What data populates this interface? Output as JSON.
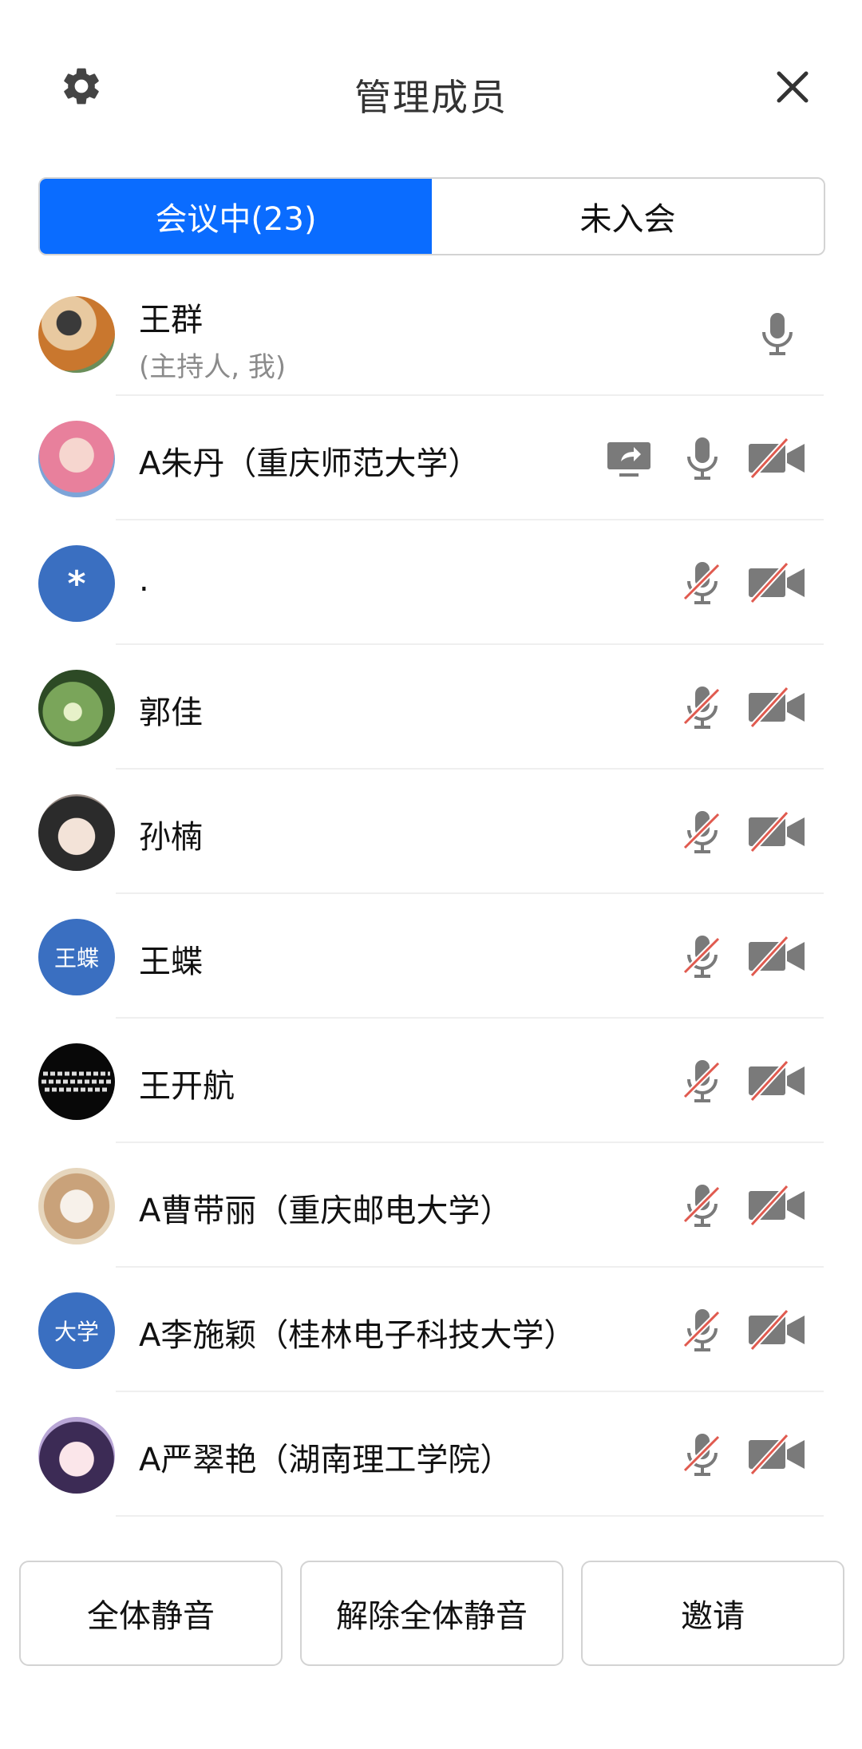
{
  "header": {
    "title": "管理成员",
    "settings_icon": "gear-icon",
    "close_icon": "close-icon"
  },
  "tabs": [
    {
      "label": "会议中(23)",
      "active": true
    },
    {
      "label": "未入会",
      "active": false
    }
  ],
  "participants": [
    {
      "name": "王群",
      "subtitle": "(主持人, 我)",
      "avatar_type": "photo",
      "mic": "on",
      "camera": null,
      "sharing": false
    },
    {
      "name": "A朱丹（重庆师范大学）",
      "avatar_type": "photo",
      "mic": "on",
      "camera": "off",
      "sharing": true
    },
    {
      "name": ".",
      "avatar_type": "initial",
      "avatar_text": "*",
      "mic": "off",
      "camera": "off",
      "sharing": false
    },
    {
      "name": "郭佳",
      "avatar_type": "photo",
      "mic": "off",
      "camera": "off",
      "sharing": false
    },
    {
      "name": "孙楠",
      "avatar_type": "photo",
      "mic": "off",
      "camera": "off",
      "sharing": false
    },
    {
      "name": "王蝶",
      "avatar_type": "initial",
      "avatar_text": "王蝶",
      "mic": "off",
      "camera": "off",
      "sharing": false
    },
    {
      "name": "王开航",
      "avatar_type": "photo",
      "mic": "off",
      "camera": "off",
      "sharing": false
    },
    {
      "name": "A曹带丽（重庆邮电大学）",
      "avatar_type": "photo",
      "mic": "off",
      "camera": "off",
      "sharing": false
    },
    {
      "name": "A李施颖（桂林电子科技大学）",
      "avatar_type": "initial",
      "avatar_text": "大学",
      "mic": "off",
      "camera": "off",
      "sharing": false
    },
    {
      "name": "A严翠艳（湖南理工学院）",
      "avatar_type": "photo",
      "mic": "off",
      "camera": "off",
      "sharing": false
    }
  ],
  "footer": {
    "mute_all": "全体静音",
    "unmute_all": "解除全体静音",
    "invite": "邀请"
  },
  "colors": {
    "accent": "#0a6cff",
    "icon_gray": "#7a7a7a",
    "muted_slash": "#e05a4f",
    "avatar_blue": "#3a6fc1"
  }
}
